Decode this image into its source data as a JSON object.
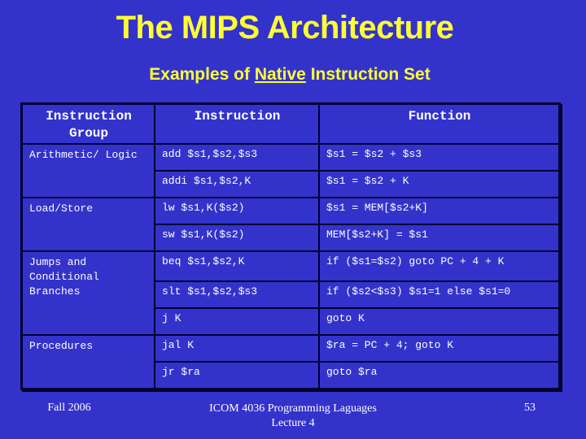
{
  "title": "The MIPS Architecture",
  "subtitle": {
    "pre": "Examples of ",
    "emph": "Native",
    "post": " Instruction Set"
  },
  "table": {
    "headers": [
      "Instruction Group",
      "Instruction",
      "Function"
    ],
    "groups": [
      {
        "name": "Arithmetic/ Logic",
        "rows": [
          {
            "instruction": "add $s1,$s2,$s3",
            "function": "$s1 = $s2 + $s3"
          },
          {
            "instruction": "addi $s1,$s2,K",
            "function": "$s1 = $s2 + K"
          }
        ]
      },
      {
        "name": "Load/Store",
        "rows": [
          {
            "instruction": "lw $s1,K($s2)",
            "function": "$s1 = MEM[$s2+K]"
          },
          {
            "instruction": "sw $s1,K($s2)",
            "function": "MEM[$s2+K] = $s1"
          }
        ]
      },
      {
        "name": "Jumps and Conditional Branches",
        "rows": [
          {
            "instruction": "beq $s1,$s2,K",
            "function": "if ($s1=$s2) goto PC + 4 + K"
          },
          {
            "instruction": "slt $s1,$s2,$s3",
            "function": "if ($s2<$s3) $s1=1 else $s1=0"
          },
          {
            "instruction": "j K",
            "function": "goto K"
          }
        ]
      },
      {
        "name": "Procedures",
        "rows": [
          {
            "instruction": "jal K",
            "function": "$ra = PC + 4; goto K"
          },
          {
            "instruction": "jr $ra",
            "function": "goto $ra"
          }
        ]
      }
    ]
  },
  "footer": {
    "left": "Fall 2006",
    "center_line1": "ICOM 4036 Programming Laguages",
    "center_line2": "Lecture 4",
    "page": "53"
  },
  "colors": {
    "background": "#3333cc",
    "title": "#ffff33",
    "text": "#ffffff",
    "border": "#000033"
  }
}
